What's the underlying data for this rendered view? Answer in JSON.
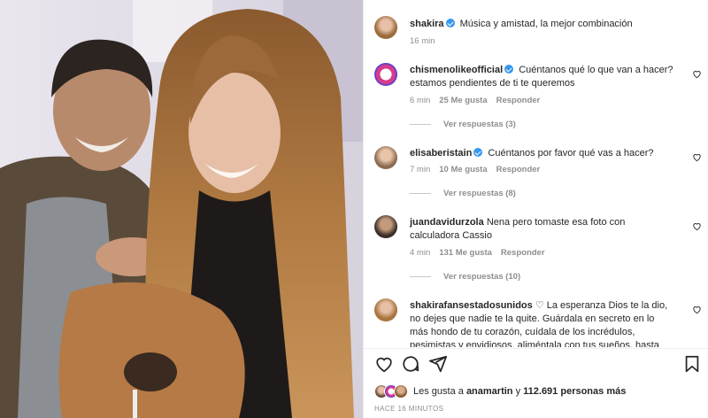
{
  "post": {
    "username": "shakira",
    "caption": "Música y amistad, la mejor combinación",
    "time": "16 min",
    "time_ago": "HACE 16 MINUTOS"
  },
  "comments": [
    {
      "username": "chismenolikeofficial",
      "verified": true,
      "text": "Cuéntanos qué lo que van a hacer? estamos pendientes de ti te queremos",
      "time": "6 min",
      "likes": "25 Me gusta",
      "reply_label": "Responder",
      "view_replies": "Ver respuestas (3)"
    },
    {
      "username": "elisaberistain",
      "verified": true,
      "text": "Cuéntanos por favor qué vas a hacer?",
      "time": "7 min",
      "likes": "10 Me gusta",
      "reply_label": "Responder",
      "view_replies": "Ver respuestas (8)"
    },
    {
      "username": "juandavidurzola",
      "verified": false,
      "text": "Nena pero tomaste esa foto con calculadora Cassio",
      "time": "4 min",
      "likes": "131 Me gusta",
      "reply_label": "Responder",
      "view_replies": "Ver respuestas (10)"
    },
    {
      "username": "shakirafansestadosunidos",
      "verified": false,
      "text": "♡ La esperanza Dios te la dio, no dejes que nadie te la quite. Guárdala en secreto en lo más hondo de tu corazón, cuídala de los incrédulos, pesimistas y envidiosos, aliméntala con tus sueños, hasta que un día salga a"
    }
  ],
  "likes_summary": {
    "prefix": "Les gusta a",
    "user": "anamartin",
    "middle": "y",
    "count": "112.691 personas más"
  },
  "colors": {
    "verified": "#3897f0",
    "meta_text": "#8e8e8e",
    "text": "#262626"
  },
  "icons": [
    "heart-icon",
    "comment-icon",
    "share-icon",
    "bookmark-icon",
    "verified-badge-icon"
  ]
}
